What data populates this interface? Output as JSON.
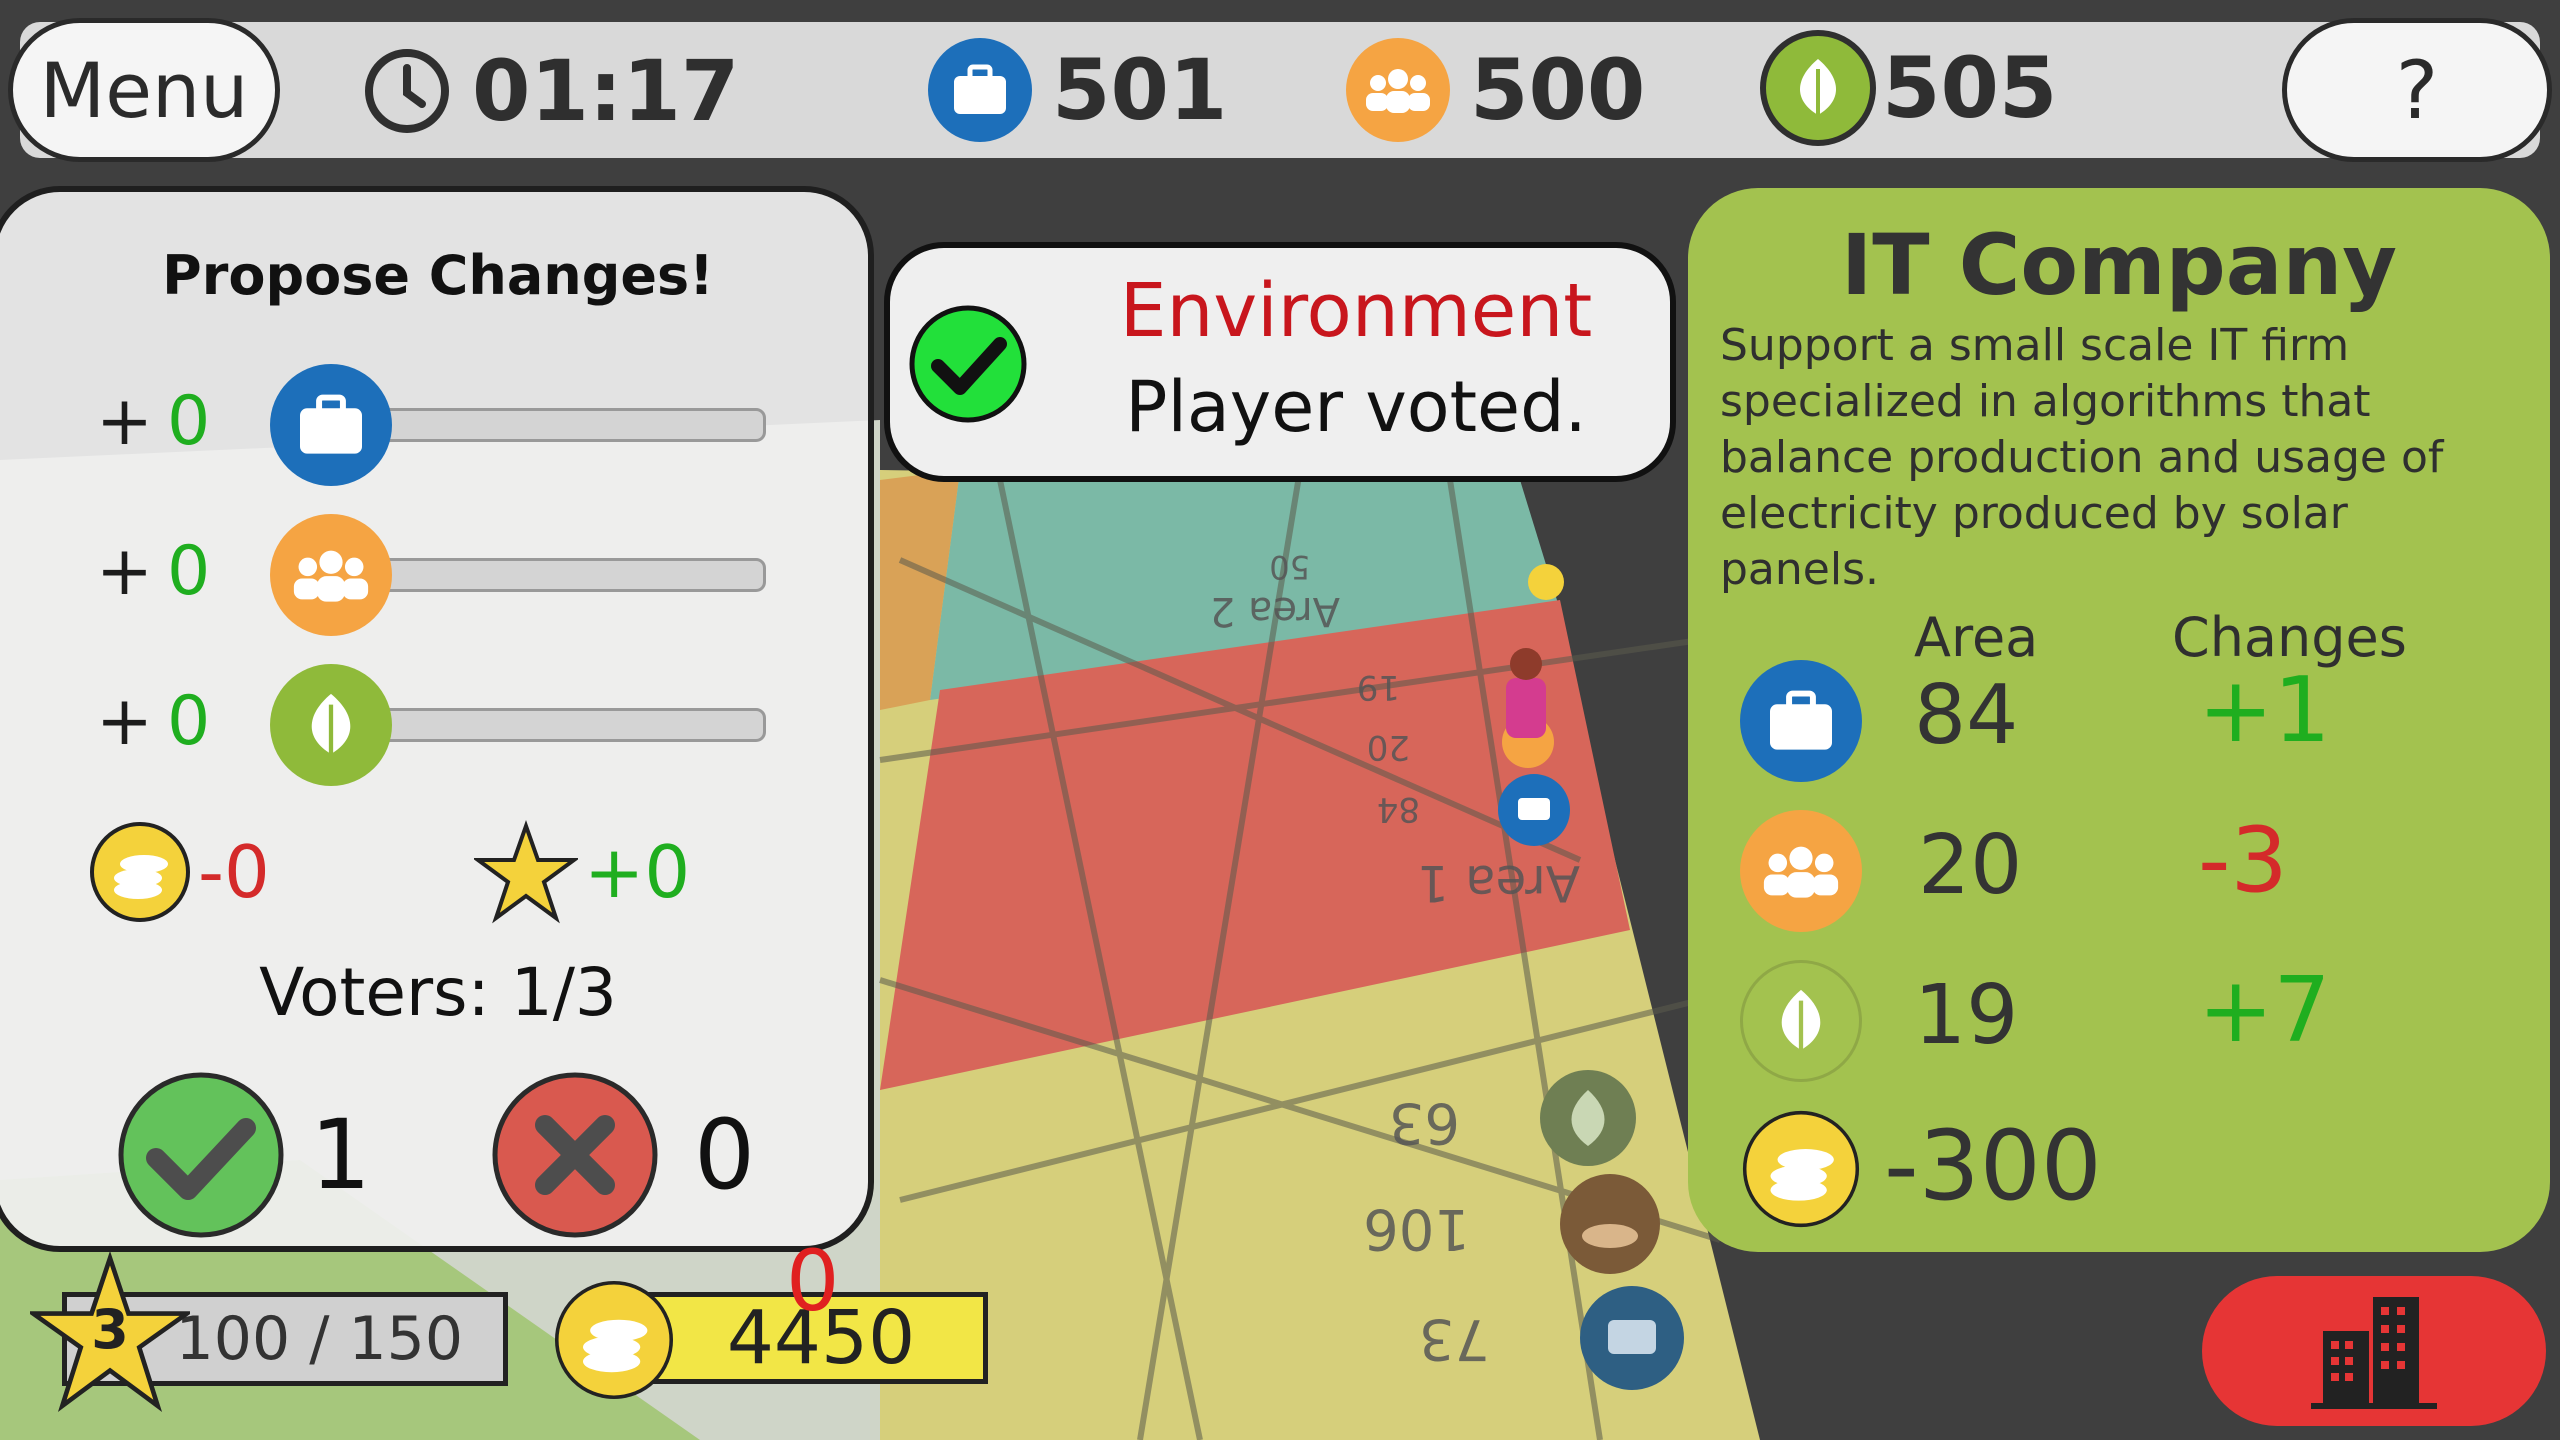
{
  "topbar": {
    "menu_label": "Menu",
    "timer": "01:17",
    "jobs_value": "501",
    "social_value": "500",
    "environment_value": "505",
    "help_label": "?"
  },
  "propose": {
    "title": "Propose Changes!",
    "rows": [
      {
        "sign": "+",
        "value": "0",
        "icon": "briefcase-icon",
        "color": "#1d6fba"
      },
      {
        "sign": "+",
        "value": "0",
        "icon": "people-icon",
        "color": "#f5a443"
      },
      {
        "sign": "+",
        "value": "0",
        "icon": "leaf-icon",
        "color": "#8fba3a"
      }
    ],
    "coin_delta": "-0",
    "star_delta": "+0",
    "voters_label": "Voters: 1/3",
    "yes_count": "1",
    "no_count": "0"
  },
  "notification": {
    "line1": "Environment",
    "line2": "Player voted."
  },
  "info": {
    "title": "IT Company",
    "description": "Support a small scale IT firm specialized in algorithms that balance production and usage of electricity produced by solar panels.",
    "col_area": "Area",
    "col_changes": "Changes",
    "rows": [
      {
        "icon": "briefcase-icon",
        "area": "84",
        "change": "+1",
        "change_color": "#1fae1f"
      },
      {
        "icon": "people-icon",
        "area": "20",
        "change": "-3",
        "change_color": "#d42a2a"
      },
      {
        "icon": "leaf-icon",
        "area": "19",
        "change": "+7",
        "change_color": "#1fae1f"
      }
    ],
    "cost": "-300"
  },
  "bottom": {
    "level": "3",
    "xp": "100 / 150",
    "coins": "4450",
    "coins_delta": "0"
  },
  "map_labels": {
    "area1": "Area 1",
    "area2": "Area 2",
    "n50": "50",
    "n19": "19",
    "n20": "20",
    "n84": "84",
    "n63": "63",
    "n106": "106",
    "n73": "73"
  },
  "colors": {
    "jobs": "#1d6fba",
    "social": "#f5a443",
    "environment": "#8fba3a",
    "panel_green": "#a3c24f",
    "build_red": "#e63535"
  }
}
